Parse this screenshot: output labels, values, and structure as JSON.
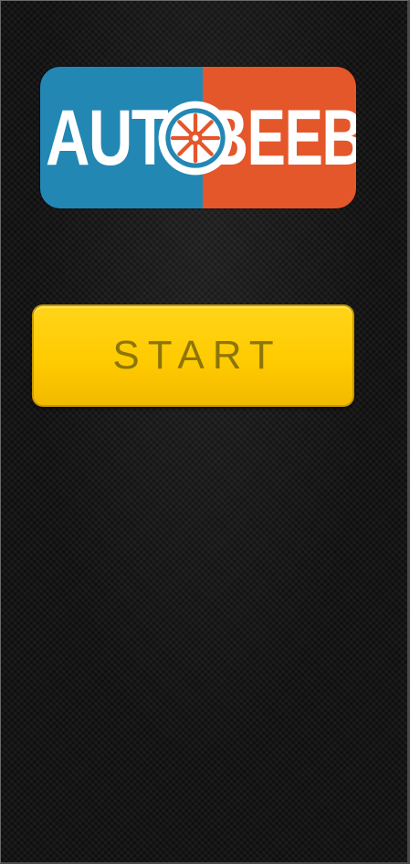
{
  "logo": {
    "text_left": "AUT",
    "text_right": "BEEB",
    "wheel_icon": "wheel-icon",
    "color_left": "#2387b4",
    "color_right": "#e4572a"
  },
  "start_button": {
    "label": "START",
    "color": "#ffcb00",
    "text_color": "#8c7508"
  }
}
